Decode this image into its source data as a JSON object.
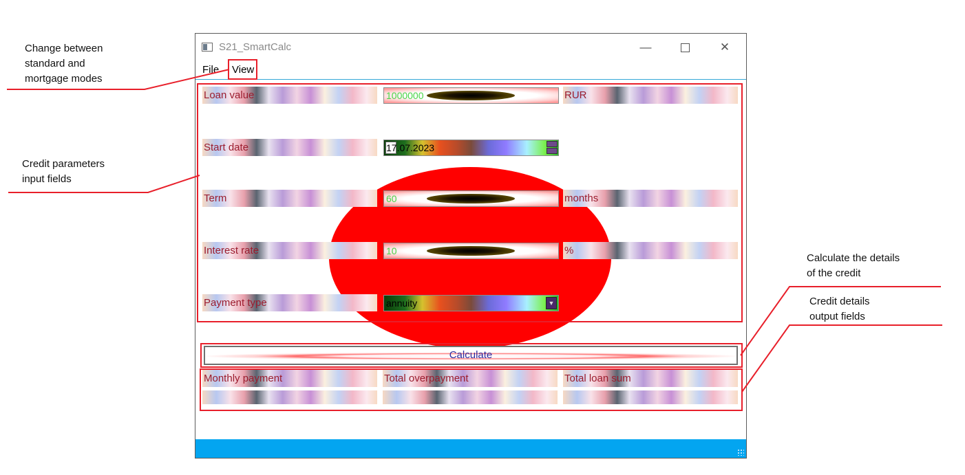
{
  "annotations": {
    "mode_switch": "Change between\nstandard and\nmortgage modes",
    "input_fields": "Credit parameters\ninput fields",
    "calculate": "Calculate the details\nof the credit",
    "output_fields": "Credit details\noutput fields"
  },
  "window": {
    "title": "S21_SmartCalc",
    "minimize_glyph": "—",
    "close_glyph": "✕"
  },
  "menu": {
    "file": "File",
    "view": "View"
  },
  "form": {
    "loan_value": {
      "label": "Loan value",
      "value": "1000000",
      "unit": "RUR"
    },
    "start_date": {
      "label": "Start date",
      "value": "17.07.2023"
    },
    "term": {
      "label": "Term",
      "value": "60",
      "unit": "months"
    },
    "interest_rate": {
      "label": "Interest rate",
      "value": "10",
      "unit": "%"
    },
    "payment_type": {
      "label": "Payment type",
      "value": "annuity"
    }
  },
  "calculate_button": "Calculate",
  "results": {
    "monthly_payment_label": "Monthly payment",
    "total_overpayment_label": "Total overpayment",
    "total_loan_sum_label": "Total loan sum",
    "monthly_payment_value": "",
    "total_overpayment_value": "",
    "total_loan_sum_value": ""
  },
  "colors": {
    "annotation_red": "#e81f2a",
    "status_bar": "#03a5f0",
    "label_text": "#9b1c2e",
    "input_text": "#49d449"
  }
}
